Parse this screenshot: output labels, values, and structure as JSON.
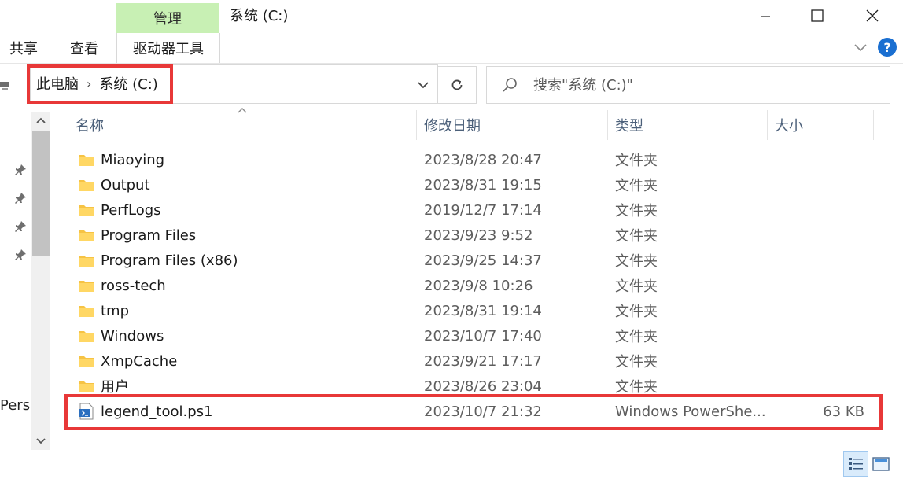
{
  "window": {
    "title": "系统 (C:)"
  },
  "ribbon": {
    "tabs": [
      {
        "label": "共享"
      },
      {
        "label": "查看"
      }
    ],
    "context_group": "管理",
    "context_tab": "驱动器工具"
  },
  "address": {
    "crumbs": [
      "此电脑",
      "系统 (C:)"
    ]
  },
  "search": {
    "placeholder": "搜索\"系统 (C:)\""
  },
  "nav_pane": {
    "truncated_label": "Persc"
  },
  "columns": {
    "name": "名称",
    "date": "修改日期",
    "type": "类型",
    "size": "大小"
  },
  "files": [
    {
      "name": "Miaoying",
      "date": "2023/8/28 20:47",
      "type": "文件夹",
      "size": "",
      "kind": "folder"
    },
    {
      "name": "Output",
      "date": "2023/8/31 19:15",
      "type": "文件夹",
      "size": "",
      "kind": "folder"
    },
    {
      "name": "PerfLogs",
      "date": "2019/12/7 17:14",
      "type": "文件夹",
      "size": "",
      "kind": "folder"
    },
    {
      "name": "Program Files",
      "date": "2023/9/23 9:52",
      "type": "文件夹",
      "size": "",
      "kind": "folder"
    },
    {
      "name": "Program Files (x86)",
      "date": "2023/9/25 14:37",
      "type": "文件夹",
      "size": "",
      "kind": "folder"
    },
    {
      "name": "ross-tech",
      "date": "2023/9/8 10:26",
      "type": "文件夹",
      "size": "",
      "kind": "folder"
    },
    {
      "name": "tmp",
      "date": "2023/8/31 19:14",
      "type": "文件夹",
      "size": "",
      "kind": "folder"
    },
    {
      "name": "Windows",
      "date": "2023/10/7 17:40",
      "type": "文件夹",
      "size": "",
      "kind": "folder"
    },
    {
      "name": "XmpCache",
      "date": "2023/9/21 17:17",
      "type": "文件夹",
      "size": "",
      "kind": "folder"
    },
    {
      "name": "用户",
      "date": "2023/8/26 23:04",
      "type": "文件夹",
      "size": "",
      "kind": "folder"
    },
    {
      "name": "legend_tool.ps1",
      "date": "2023/10/7 21:32",
      "type": "Windows PowerShe...",
      "size": "63 KB",
      "kind": "ps1"
    }
  ],
  "colors": {
    "context_tab_bg": "#c8f0b4",
    "highlight_red": "#e83838",
    "help_blue": "#1a6fd1",
    "folder_yellow": "#f6c344"
  }
}
